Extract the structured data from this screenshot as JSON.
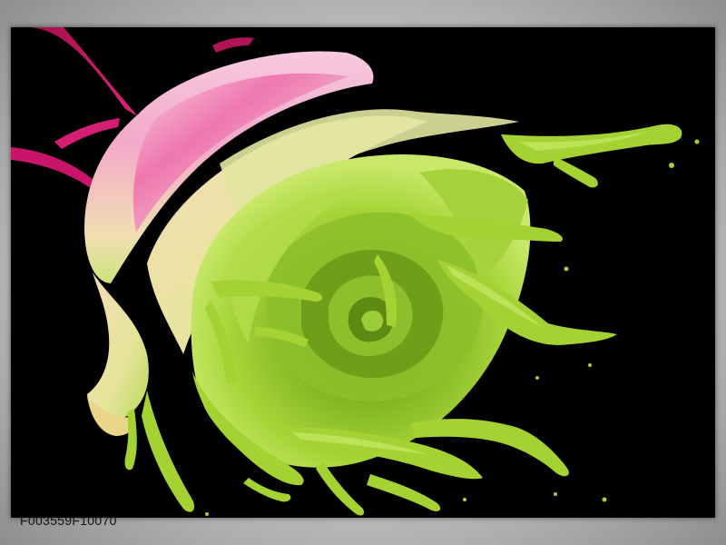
{
  "product_code": "F003559F10070",
  "colors": {
    "background": "#000000",
    "petal_pink": "#e83a8c",
    "petal_light": "#f6c6dc",
    "petal_cream": "#f3e6b4",
    "paint_green": "#9fd02a",
    "paint_green_dark": "#5e8a14",
    "stem_magenta": "#c0145a",
    "frame_grey": "#cfcfcf"
  }
}
